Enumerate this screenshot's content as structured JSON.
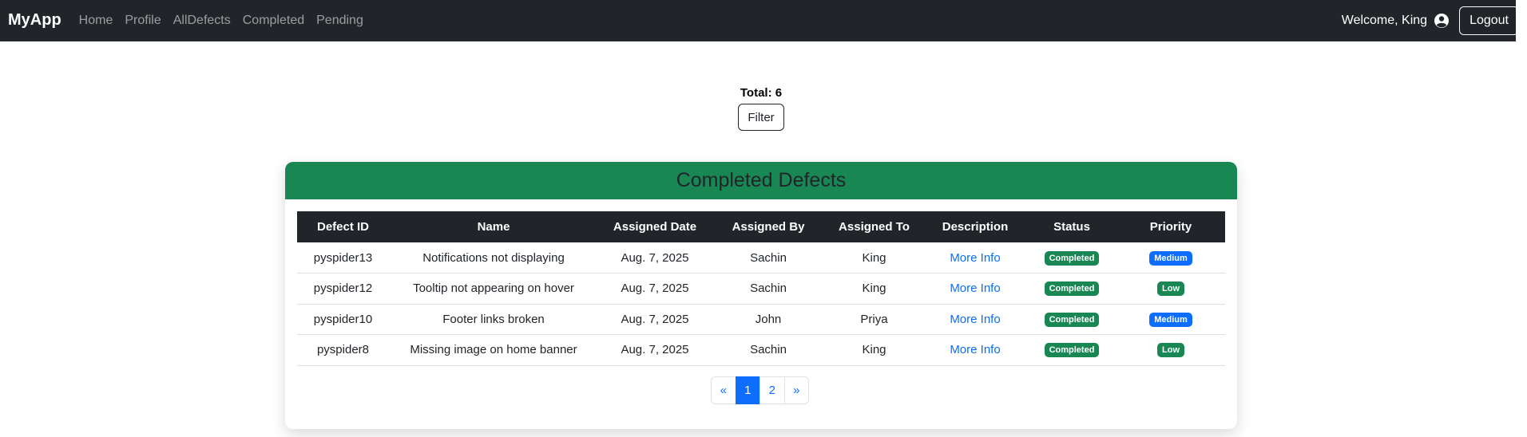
{
  "navbar": {
    "brand": "MyApp",
    "links": [
      "Home",
      "Profile",
      "AllDefects",
      "Completed",
      "Pending"
    ],
    "welcome": "Welcome, King",
    "user_icon": "user-circle-icon",
    "logout": "Logout"
  },
  "summary": {
    "total": "Total: 6",
    "filter": "Filter"
  },
  "card": {
    "title": "Completed Defects"
  },
  "table": {
    "headers": [
      "Defect ID",
      "Name",
      "Assigned Date",
      "Assigned By",
      "Assigned To",
      "Description",
      "Status",
      "Priority"
    ],
    "rows": [
      {
        "id": "pyspider13",
        "name": "Notifications not displaying",
        "date": "Aug. 7, 2025",
        "by": "Sachin",
        "to": "King",
        "desc": "More Info",
        "status": "Completed",
        "priority": "Medium"
      },
      {
        "id": "pyspider12",
        "name": "Tooltip not appearing on hover",
        "date": "Aug. 7, 2025",
        "by": "Sachin",
        "to": "King",
        "desc": "More Info",
        "status": "Completed",
        "priority": "Low"
      },
      {
        "id": "pyspider10",
        "name": "Footer links broken",
        "date": "Aug. 7, 2025",
        "by": "John",
        "to": "Priya",
        "desc": "More Info",
        "status": "Completed",
        "priority": "Medium"
      },
      {
        "id": "pyspider8",
        "name": "Missing image on home banner",
        "date": "Aug. 7, 2025",
        "by": "Sachin",
        "to": "King",
        "desc": "More Info",
        "status": "Completed",
        "priority": "Low"
      }
    ]
  },
  "pagination": {
    "prev": "«",
    "pages": [
      "1",
      "2"
    ],
    "current": "1",
    "next": "»"
  },
  "colors": {
    "navbar_bg": "#212529",
    "card_header_bg": "#198754",
    "badge_completed": "#198754",
    "badge_medium": "#0d6efd",
    "badge_low": "#198754",
    "link": "#0d6efd"
  }
}
